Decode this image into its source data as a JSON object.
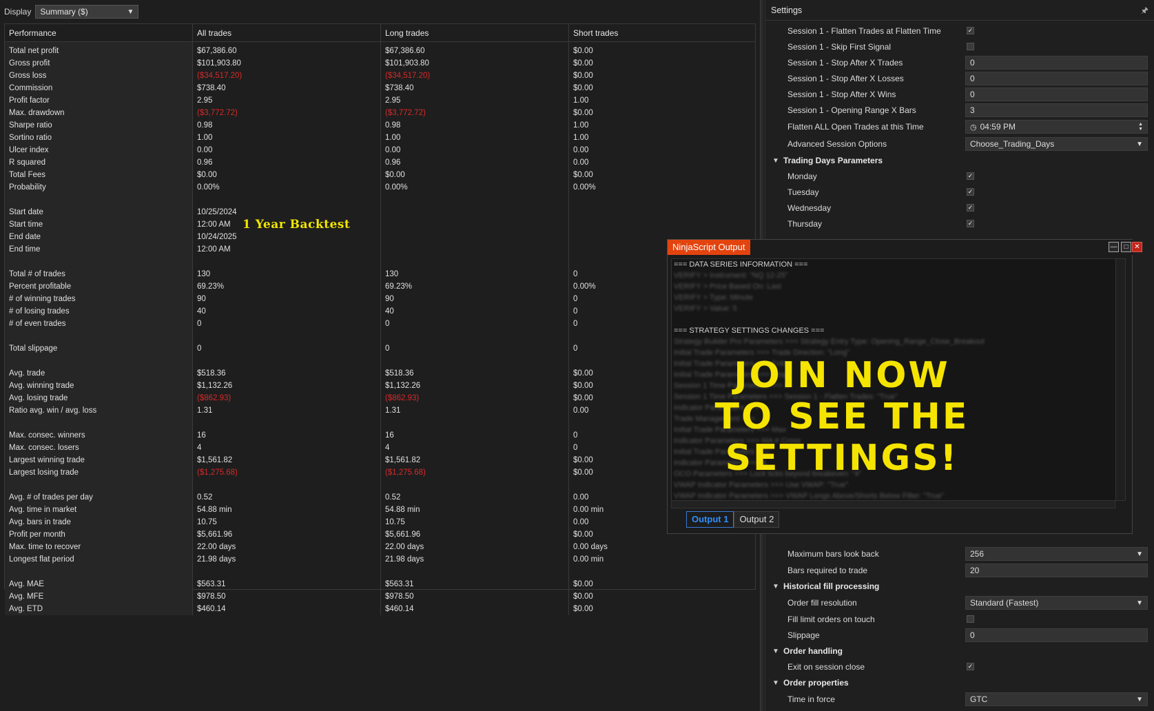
{
  "display": {
    "label": "Display",
    "selected": "Summary ($)"
  },
  "performance": {
    "headers": [
      "Performance",
      "All trades",
      "Long trades",
      "Short trades"
    ],
    "rows": [
      {
        "label": "Total net profit",
        "all": "$67,386.60",
        "long": "$67,386.60",
        "short": "$0.00"
      },
      {
        "label": "Gross profit",
        "all": "$101,903.80",
        "long": "$101,903.80",
        "short": "$0.00"
      },
      {
        "label": "Gross loss",
        "all": "($34,517.20)",
        "long": "($34,517.20)",
        "short": "$0.00",
        "neg": true
      },
      {
        "label": "Commission",
        "all": "$738.40",
        "long": "$738.40",
        "short": "$0.00"
      },
      {
        "label": "Profit factor",
        "all": "2.95",
        "long": "2.95",
        "short": "1.00"
      },
      {
        "label": "Max. drawdown",
        "all": "($3,772.72)",
        "long": "($3,772.72)",
        "short": "$0.00",
        "neg": true
      },
      {
        "label": "Sharpe ratio",
        "all": "0.98",
        "long": "0.98",
        "short": "1.00"
      },
      {
        "label": "Sortino ratio",
        "all": "1.00",
        "long": "1.00",
        "short": "1.00"
      },
      {
        "label": "Ulcer index",
        "all": "0.00",
        "long": "0.00",
        "short": "0.00"
      },
      {
        "label": "R squared",
        "all": "0.96",
        "long": "0.96",
        "short": "0.00"
      },
      {
        "label": "Total Fees",
        "all": "$0.00",
        "long": "$0.00",
        "short": "$0.00"
      },
      {
        "label": "Probability",
        "all": "0.00%",
        "long": "0.00%",
        "short": "0.00%"
      },
      {
        "blank": true
      },
      {
        "label": "Start date",
        "all": "10/25/2024",
        "long": "",
        "short": ""
      },
      {
        "label": "Start time",
        "all": "12:00 AM",
        "long": "",
        "short": ""
      },
      {
        "label": "End date",
        "all": "10/24/2025",
        "long": "",
        "short": ""
      },
      {
        "label": "End time",
        "all": "12:00 AM",
        "long": "",
        "short": ""
      },
      {
        "blank": true
      },
      {
        "label": "Total # of trades",
        "all": "130",
        "long": "130",
        "short": "0"
      },
      {
        "label": "Percent profitable",
        "all": "69.23%",
        "long": "69.23%",
        "short": "0.00%"
      },
      {
        "label": "# of winning trades",
        "all": "90",
        "long": "90",
        "short": "0"
      },
      {
        "label": "# of losing trades",
        "all": "40",
        "long": "40",
        "short": "0"
      },
      {
        "label": "# of even trades",
        "all": "0",
        "long": "0",
        "short": "0"
      },
      {
        "blank": true
      },
      {
        "label": "Total slippage",
        "all": "0",
        "long": "0",
        "short": "0"
      },
      {
        "blank": true
      },
      {
        "label": "Avg. trade",
        "all": "$518.36",
        "long": "$518.36",
        "short": "$0.00"
      },
      {
        "label": "Avg. winning trade",
        "all": "$1,132.26",
        "long": "$1,132.26",
        "short": "$0.00"
      },
      {
        "label": "Avg. losing trade",
        "all": "($862.93)",
        "long": "($862.93)",
        "short": "$0.00",
        "neg": true
      },
      {
        "label": "Ratio avg. win / avg. loss",
        "all": "1.31",
        "long": "1.31",
        "short": "0.00"
      },
      {
        "blank": true
      },
      {
        "label": "Max. consec. winners",
        "all": "16",
        "long": "16",
        "short": "0"
      },
      {
        "label": "Max. consec. losers",
        "all": "4",
        "long": "4",
        "short": "0"
      },
      {
        "label": "Largest winning trade",
        "all": "$1,561.82",
        "long": "$1,561.82",
        "short": "$0.00"
      },
      {
        "label": "Largest losing trade",
        "all": "($1,275.68)",
        "long": "($1,275.68)",
        "short": "$0.00",
        "neg": true
      },
      {
        "blank": true
      },
      {
        "label": "Avg. # of trades per day",
        "all": "0.52",
        "long": "0.52",
        "short": "0.00"
      },
      {
        "label": "Avg. time in market",
        "all": "54.88 min",
        "long": "54.88 min",
        "short": "0.00 min"
      },
      {
        "label": "Avg. bars in trade",
        "all": "10.75",
        "long": "10.75",
        "short": "0.00"
      },
      {
        "label": "Profit per month",
        "all": "$5,661.96",
        "long": "$5,661.96",
        "short": "$0.00"
      },
      {
        "label": "Max. time to recover",
        "all": "22.00 days",
        "long": "22.00 days",
        "short": "0.00 days"
      },
      {
        "label": "Longest flat period",
        "all": "21.98 days",
        "long": "21.98 days",
        "short": "0.00 min"
      },
      {
        "blank": true
      },
      {
        "label": "Avg. MAE",
        "all": "$563.31",
        "long": "$563.31",
        "short": "$0.00"
      },
      {
        "label": "Avg. MFE",
        "all": "$978.50",
        "long": "$978.50",
        "short": "$0.00"
      },
      {
        "label": "Avg. ETD",
        "all": "$460.14",
        "long": "$460.14",
        "short": "$0.00"
      }
    ]
  },
  "backtest_label": "1 Year Backtest",
  "settings": {
    "title": "Settings",
    "pin_icon": "pin-icon",
    "rows_top": [
      {
        "type": "prop",
        "name": "Session 1 - Flatten Trades at Flatten Time",
        "kind": "check",
        "value": "✓"
      },
      {
        "type": "prop",
        "name": "Session 1 - Skip First Signal",
        "kind": "check",
        "value": ""
      },
      {
        "type": "prop",
        "name": "Session 1 - Stop After X Trades",
        "kind": "text",
        "value": "0"
      },
      {
        "type": "prop",
        "name": "Session 1 - Stop After X Losses",
        "kind": "text",
        "value": "0"
      },
      {
        "type": "prop",
        "name": "Session 1 - Stop After X Wins",
        "kind": "text",
        "value": "0"
      },
      {
        "type": "prop",
        "name": "Session 1 - Opening Range X Bars",
        "kind": "text",
        "value": "3"
      },
      {
        "type": "prop",
        "name": "Flatten ALL Open Trades at this Time",
        "kind": "time",
        "value": "04:59 PM"
      },
      {
        "type": "prop",
        "name": "Advanced Session Options",
        "kind": "dropdown",
        "value": "Choose_Trading_Days"
      },
      {
        "type": "cat",
        "name": "Trading Days Parameters"
      },
      {
        "type": "prop",
        "name": "Monday",
        "kind": "check",
        "value": "✓"
      },
      {
        "type": "prop",
        "name": "Tuesday",
        "kind": "check",
        "value": "✓"
      },
      {
        "type": "prop",
        "name": "Wednesday",
        "kind": "check",
        "value": "✓"
      },
      {
        "type": "prop",
        "name": "Thursday",
        "kind": "check",
        "value": "✓"
      }
    ],
    "rows_bottom": [
      {
        "type": "prop",
        "name": "Maximum bars look back",
        "kind": "dropdown",
        "value": "256"
      },
      {
        "type": "prop",
        "name": "Bars required to trade",
        "kind": "text",
        "value": "20"
      },
      {
        "type": "cat",
        "name": "Historical fill processing"
      },
      {
        "type": "prop",
        "name": "Order fill resolution",
        "kind": "dropdown",
        "value": "Standard (Fastest)"
      },
      {
        "type": "prop",
        "name": "Fill limit orders on touch",
        "kind": "check",
        "value": ""
      },
      {
        "type": "prop",
        "name": "Slippage",
        "kind": "text",
        "value": "0"
      },
      {
        "type": "cat",
        "name": "Order handling"
      },
      {
        "type": "prop",
        "name": "Exit on session close",
        "kind": "check",
        "value": "✓"
      },
      {
        "type": "cat",
        "name": "Order properties"
      },
      {
        "type": "prop",
        "name": "Time in force",
        "kind": "dropdown",
        "value": "GTC"
      }
    ]
  },
  "output_window": {
    "title": "NinjaScript Output",
    "lines": [
      {
        "text": "=== DATA SERIES INFORMATION ===",
        "blur": false
      },
      {
        "text": "VERIFY > Instrument: \"NQ 12-25\"",
        "blur": true
      },
      {
        "text": "VERIFY > Price Based On: Last",
        "blur": true
      },
      {
        "text": "VERIFY > Type: Minute",
        "blur": true
      },
      {
        "text": "VERIFY > Value: 5",
        "blur": true
      },
      {
        "text": "",
        "blur": false
      },
      {
        "text": "=== STRATEGY SETTINGS CHANGES ===",
        "blur": false
      },
      {
        "text": "Strategy Builder Pro Parameters >>> Strategy Entry Type: Opening_Range_Close_Breakout",
        "blur": true
      },
      {
        "text": "Initial Trade Parameters >>> Trade Direction: \"Long\"",
        "blur": true
      },
      {
        "text": "Initial Trade Parameters >>> Entry",
        "blur": true
      },
      {
        "text": "Initial Trade Parameters >>> Stop",
        "blur": true
      },
      {
        "text": "Session 1 Time Parameters >>> X",
        "blur": true
      },
      {
        "text": "Session 1 Time Parameters >>> Session 1 - Flatten Trades: \"True\"",
        "blur": true
      },
      {
        "text": "Indicator Parameters >>>",
        "blur": true
      },
      {
        "text": "Trade Management >>>",
        "blur": true
      },
      {
        "text": "Initial Trade Parameters >>> Max",
        "blur": true
      },
      {
        "text": "Indicator Parameters >>> MA # Cross",
        "blur": true
      },
      {
        "text": "Initial Trade Parameters >>>",
        "blur": true
      },
      {
        "text": "Indicator Parameters >>> A",
        "blur": true
      },
      {
        "text": "OCO Parameters >>> Lock ticks beyond breakeven: \"4\"",
        "blur": true
      },
      {
        "text": "VWAP Indicator Parameters >>> Use VWAP: \"True\"",
        "blur": true
      },
      {
        "text": "VWAP Indicator Parameters >>> VWAP Longs Above/Shorts Below Filter: \"True\"",
        "blur": true
      }
    ],
    "tabs": [
      "Output 1",
      "Output 2"
    ],
    "active_tab": "Output 1",
    "overlay_lines": [
      "JOIN NOW",
      "TO SEE THE",
      "SETTINGS!"
    ]
  }
}
